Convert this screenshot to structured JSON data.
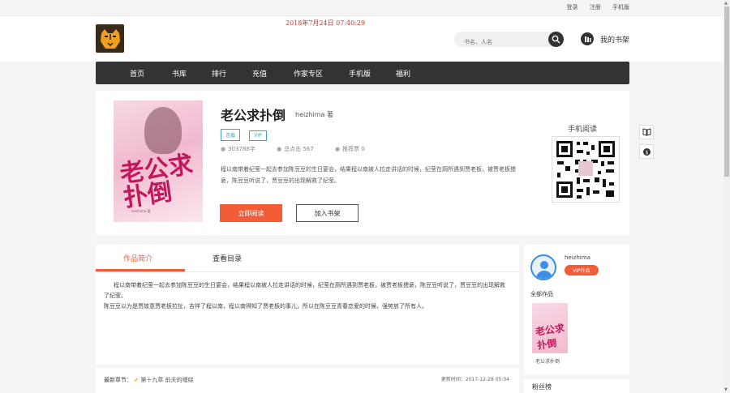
{
  "topbar": {
    "links": [
      "登录",
      "注册",
      "手机版"
    ]
  },
  "header": {
    "datetime": "2018年7月24日  07:40:29",
    "search_placeholder": "书名、人名",
    "shelf_label": "我的书架"
  },
  "nav": {
    "items": [
      "首页",
      "书库",
      "排行",
      "充值",
      "作家专区",
      "手机版",
      "福利"
    ]
  },
  "book": {
    "title": "老公求扑倒",
    "author": "heizhima",
    "author_suffix": "著",
    "tags": [
      "连载",
      "VIP"
    ],
    "words": "303788字",
    "total_clicks": "总点击 567",
    "recommend": "推荐票 0",
    "description": "程以南带着纪莹一起去参加陈豆豆的生日宴会，结果程以南被人拉走讲话的时候，纪莹在厕所遇到贾老板，被贾老板猥亵，陈豆豆听说了，贾豆豆的出现解救了纪莹。",
    "read_button": "立即阅读",
    "shelf_button": "加入书架",
    "mobile_read": "手机阅读",
    "cover_title": "老公求扑倒",
    "cover_sub": "heizhima 著"
  },
  "tabs": {
    "intro": "作品简介",
    "catalog": "查看目录"
  },
  "intro": {
    "p1": "程以南带着纪莹一起去参加陈豆豆的生日宴会，结果程以南被人拉走讲话的时候，纪莹在厕所遇到贾老板，被贾老板猥亵，陈豆豆听说了，贾豆豆的出现解救了纪莹。",
    "p2": "陈豆豆以为是贾故意贾老板拉扯，吉祥了程以南，程以南得知了贾老板的事儿，所以在陈豆豆青春恋爱的时候，强势放了所有人。"
  },
  "latest": {
    "label": "最新章节：",
    "chapter": "第十九章 前夫的缠绕",
    "updated": "更新时间：2017-12-28 05:04"
  },
  "author_panel": {
    "name": "heizhima",
    "badge": "VIP作品",
    "works_title": "全部作品",
    "work_name": "老公求扑倒",
    "cover_title": "老公求扑倒"
  },
  "fans": {
    "title": "粉丝榜"
  }
}
